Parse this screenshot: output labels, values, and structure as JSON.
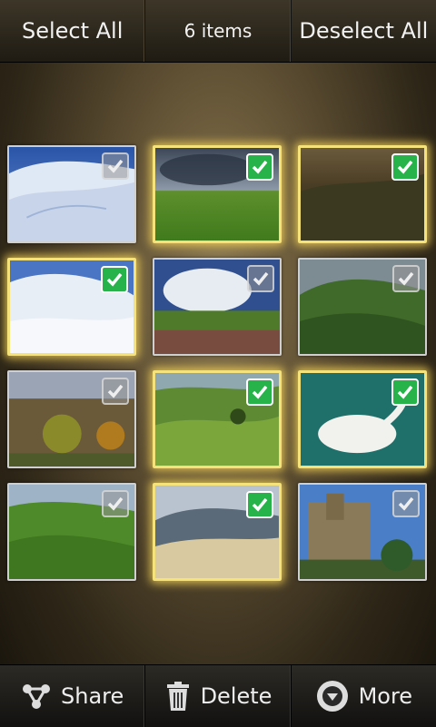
{
  "topbar": {
    "select_all": "Select All",
    "count": "6 items",
    "deselect_all": "Deselect All"
  },
  "photos": [
    {
      "id": "snow-tracks",
      "selected": false
    },
    {
      "id": "green-field-clouds",
      "selected": true
    },
    {
      "id": "dusk-hills",
      "selected": true
    },
    {
      "id": "snow-slope",
      "selected": true
    },
    {
      "id": "cumulus-farm",
      "selected": false
    },
    {
      "id": "grassy-ridge",
      "selected": false
    },
    {
      "id": "autumn-trees",
      "selected": false
    },
    {
      "id": "green-valley-tree",
      "selected": true
    },
    {
      "id": "white-swan",
      "selected": true
    },
    {
      "id": "rolling-green-hills",
      "selected": false
    },
    {
      "id": "misty-hills",
      "selected": true
    },
    {
      "id": "castle-tower",
      "selected": false
    }
  ],
  "bottombar": {
    "share": "Share",
    "delete": "Delete",
    "more": "More"
  },
  "colors": {
    "selected_check": "#27b24a",
    "selected_glow": "#f5e27a"
  }
}
